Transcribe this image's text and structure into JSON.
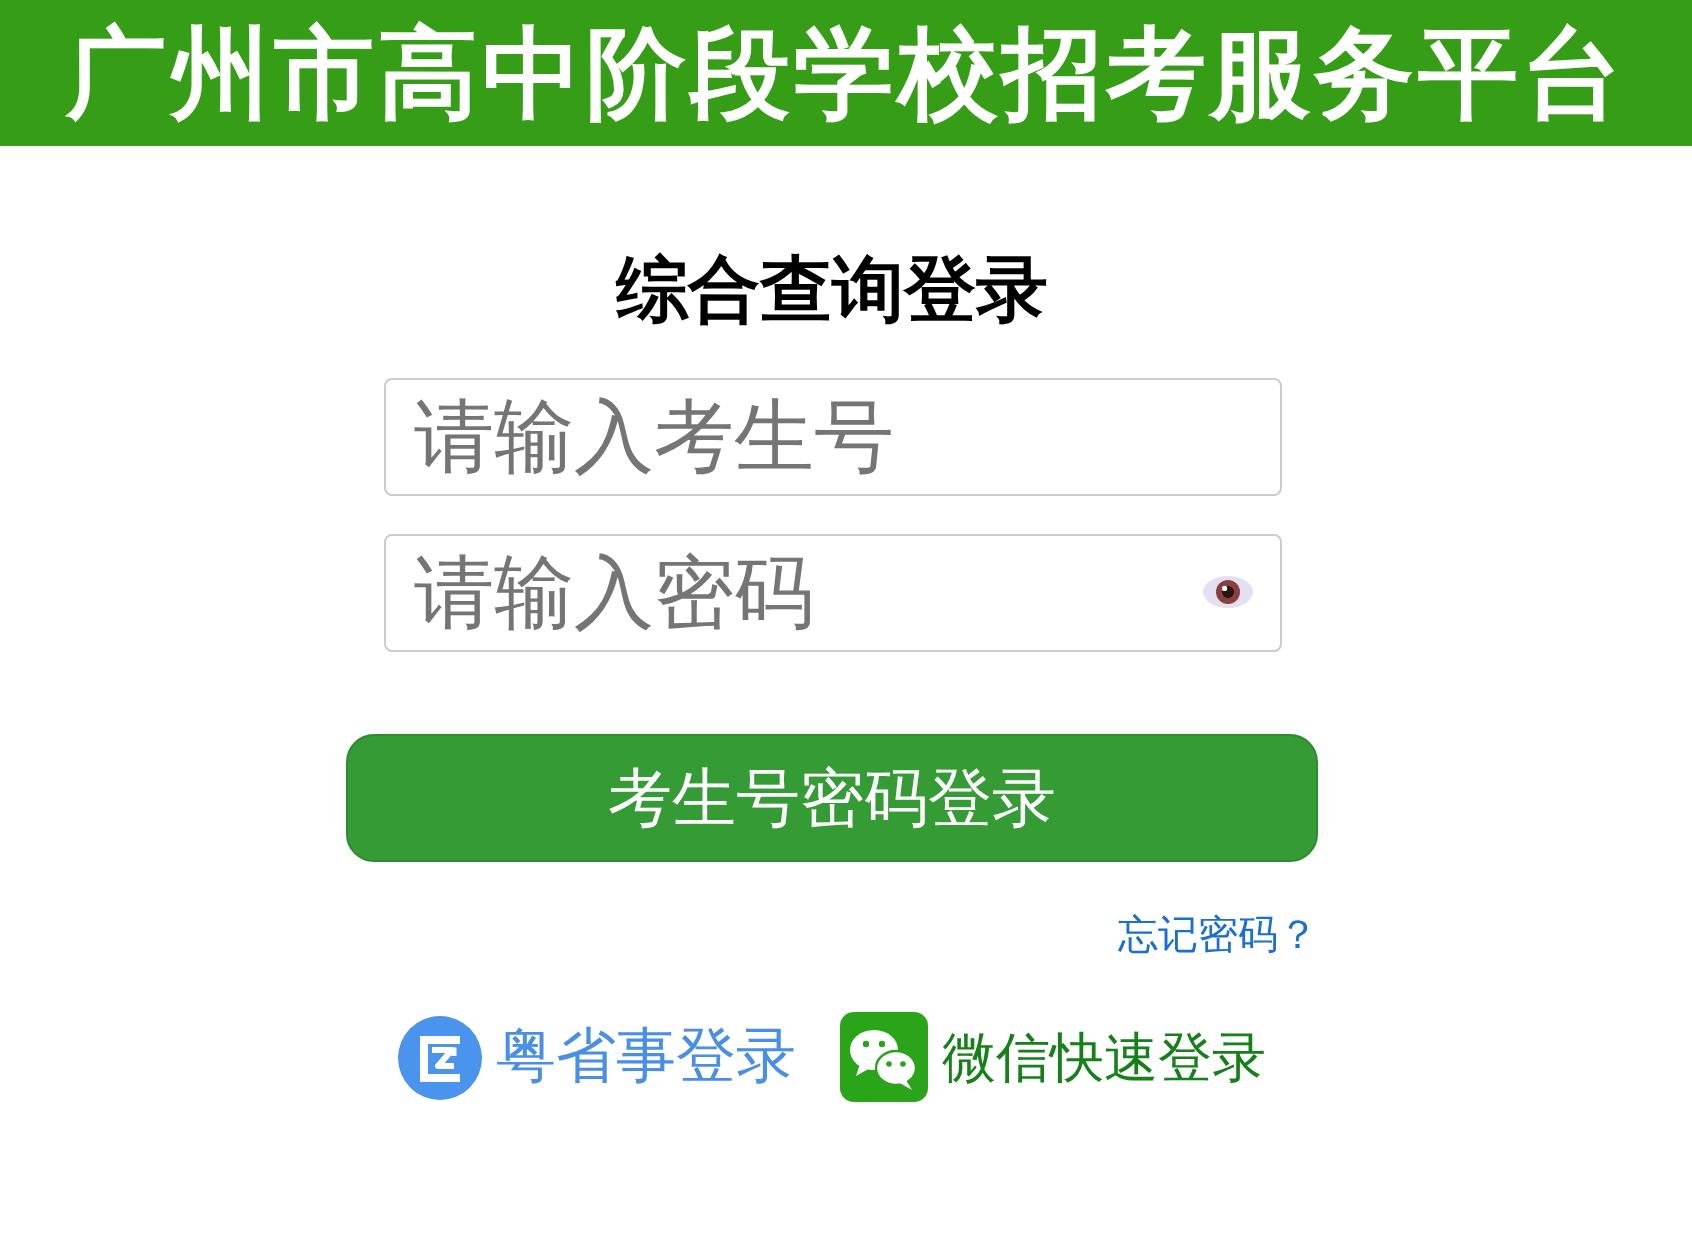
{
  "header": {
    "title": "广州市高中阶段学校招考服务平台"
  },
  "login": {
    "heading": "综合查询登录",
    "fields": [
      {
        "kind": "text",
        "placeholder": "请输入考生号"
      },
      {
        "kind": "password",
        "placeholder": "请输入密码"
      }
    ],
    "submit_button": "考生号密码登录",
    "forgot_link": "忘记密码？"
  },
  "alt_logins": [
    {
      "kind": "yueshengshi",
      "label": "粤省事登录"
    },
    {
      "kind": "wechat",
      "label": "微信快速登录"
    }
  ]
}
